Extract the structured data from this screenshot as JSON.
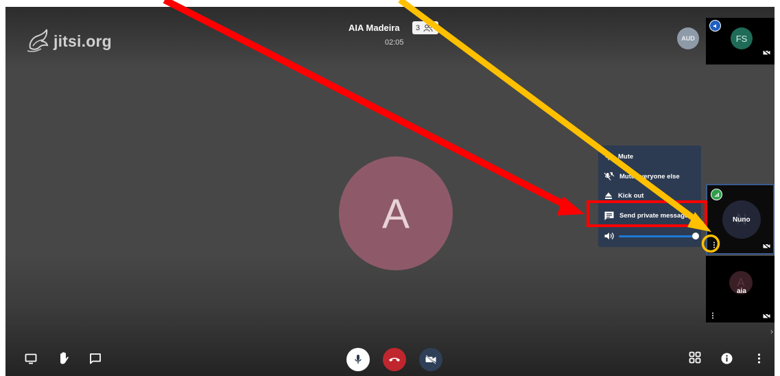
{
  "logo": {
    "text": "jitsi.org",
    "icon": "jitsi-logo-icon"
  },
  "header": {
    "conference_name": "AIA Madeira",
    "participant_count": "3",
    "timer": "02:05"
  },
  "remote_badge": {
    "label": "AUD"
  },
  "main_stage": {
    "avatar_initial": "A",
    "avatar_color": "#8e5a6a"
  },
  "filmstrip": {
    "tiles": [
      {
        "id": "fs",
        "avatar_initials": "FS",
        "avatar_color": "#1e6b58",
        "indicator": "speaker-icon",
        "camera": "camera-off-icon"
      },
      {
        "id": "nuno",
        "avatar_initials": "N",
        "display_name": "Nuno",
        "avatar_color": "#222636",
        "indicator": "connection-good-icon",
        "camera": "camera-off-icon",
        "menu": "more-vertical-icon"
      },
      {
        "id": "aia",
        "avatar_initials": "A",
        "display_name": "aia",
        "avatar_color": "#3a1f26",
        "camera": "camera-off-icon",
        "menu": "more-vertical-icon"
      }
    ]
  },
  "context_menu": {
    "items": [
      {
        "label": "Mute",
        "icon": "mic-mute-icon"
      },
      {
        "label": "Mute everyone else",
        "icon": "mute-all-icon"
      },
      {
        "label": "Kick out",
        "icon": "eject-icon"
      },
      {
        "label": "Send private message",
        "icon": "chat-bubble-icon"
      }
    ],
    "volume": {
      "icon": "volume-icon",
      "level": 1.0
    }
  },
  "toolbar": {
    "left": [
      "screen-share-icon",
      "raise-hand-icon",
      "chat-icon"
    ],
    "center": [
      "microphone-icon",
      "hangup-icon",
      "camera-off-icon"
    ],
    "right": [
      "tile-view-icon",
      "info-icon",
      "more-vertical-icon"
    ],
    "colors": {
      "hangup": "#c0262d",
      "mic": "#ffffff",
      "camera": "#2f3f58"
    }
  },
  "annotations": {
    "red_arrow_color": "#ff0000",
    "yellow_arrow_color": "#ffc000"
  }
}
